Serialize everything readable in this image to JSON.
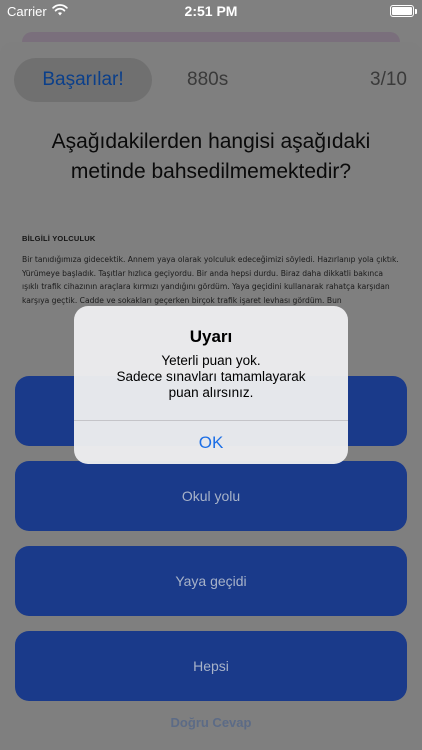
{
  "status_bar": {
    "carrier": "Carrier",
    "time": "2:51 PM",
    "wifi_icon": "wifi-icon",
    "battery_icon": "battery-icon"
  },
  "header": {
    "achievements_label": "Başarılar!",
    "timer": "880s",
    "progress": "3/10"
  },
  "question": "Aşağıdakilerden hangisi aşağıdaki metinde bahsedilmemektedir?",
  "passage": {
    "title": "BİLGİLİ YOLCULUK",
    "text": "Bir tanıdığımıza gidecektik. Annem yaya olarak yolculuk edeceğimizi söyledi. Hazırlanıp yola çıktık. Yürümeye başladık. Taşıtlar hızlıca geçiyordu. Bir anda hepsi durdu. Biraz daha dikkatli bakınca ışıklı trafik cihazının araçlara kırmızı yandığını gördüm. Yaya geçidini kullanarak rahatça karşıdan karşıya geçtik. Cadde ve sokakları geçerken birçok trafik işaret levhası gördüm. Bun"
  },
  "answers": [
    {
      "label": ""
    },
    {
      "label": "Okul yolu"
    },
    {
      "label": "Yaya geçidi"
    },
    {
      "label": "Hepsi"
    }
  ],
  "correct_answer_label": "Doğru Cevap",
  "alert": {
    "title": "Uyarı",
    "message_lines": [
      "Yeterli puan yok.",
      "Sadece sınavları tamamlayarak",
      "puan alırsınız."
    ],
    "ok_label": "OK"
  },
  "colors": {
    "answer_button": "#1a3a8a",
    "accent": "#1d6fe6",
    "overlay": "#808080"
  }
}
